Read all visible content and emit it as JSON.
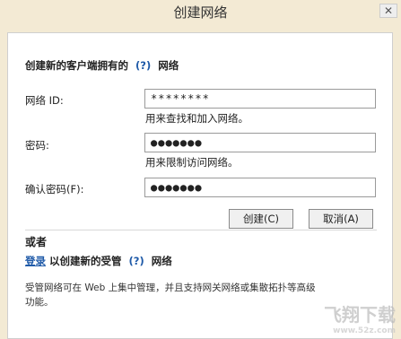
{
  "window": {
    "title": "创建网络",
    "close": "✕"
  },
  "heading": {
    "prefix": "创建新的客户端拥有的",
    "help": "(?)",
    "suffix": "网络"
  },
  "fields": {
    "network_id": {
      "label": "网络 ID:",
      "value": "********",
      "hint": "用来查找和加入网络。"
    },
    "password": {
      "label": "密码:",
      "value": "●●●●●●●",
      "hint": "用来限制访问网络。"
    },
    "confirm": {
      "label": "确认密码(F):",
      "value": "●●●●●●●"
    }
  },
  "buttons": {
    "create": "创建(C)",
    "cancel": "取消(A)"
  },
  "or_label": "或者",
  "managed": {
    "login": "登录",
    "text": "以创建新的受管",
    "help": "(?)",
    "suffix": "网络"
  },
  "description": "受管网络可在 Web 上集中管理，并且支持网关网络或集散拓扑等高级功能。",
  "watermark": {
    "brand": "飞翔下载",
    "url": "www.52z.com"
  }
}
